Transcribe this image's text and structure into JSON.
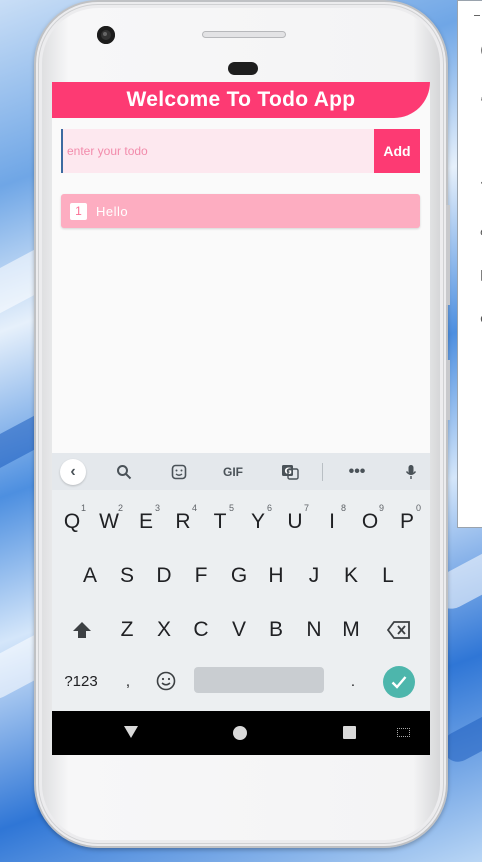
{
  "app": {
    "title": "Welcome To Todo App",
    "input_placeholder": "enter your todo",
    "input_value": "",
    "add_label": "Add",
    "todos": [
      {
        "number": "1",
        "text": "Hello"
      }
    ],
    "accent_color": "#fd3a73",
    "item_color": "#fdadc1"
  },
  "keyboard": {
    "toolbar_icons": [
      "chevron-left-icon",
      "search-icon",
      "sticker-icon",
      "gif-icon",
      "translate-icon",
      "more-icon",
      "mic-icon"
    ],
    "gif_label": "GIF",
    "row1": [
      {
        "key": "Q",
        "hint": "1"
      },
      {
        "key": "W",
        "hint": "2"
      },
      {
        "key": "E",
        "hint": "3"
      },
      {
        "key": "R",
        "hint": "4"
      },
      {
        "key": "T",
        "hint": "5"
      },
      {
        "key": "Y",
        "hint": "6"
      },
      {
        "key": "U",
        "hint": "7"
      },
      {
        "key": "I",
        "hint": "8"
      },
      {
        "key": "O",
        "hint": "9"
      },
      {
        "key": "P",
        "hint": "0"
      }
    ],
    "row2": [
      "A",
      "S",
      "D",
      "F",
      "G",
      "H",
      "J",
      "K",
      "L"
    ],
    "row3": [
      "Z",
      "X",
      "C",
      "V",
      "B",
      "N",
      "M"
    ],
    "symbols_label": "?123",
    "comma_label": ",",
    "period_label": ".",
    "enter_color": "#4db6ac"
  }
}
